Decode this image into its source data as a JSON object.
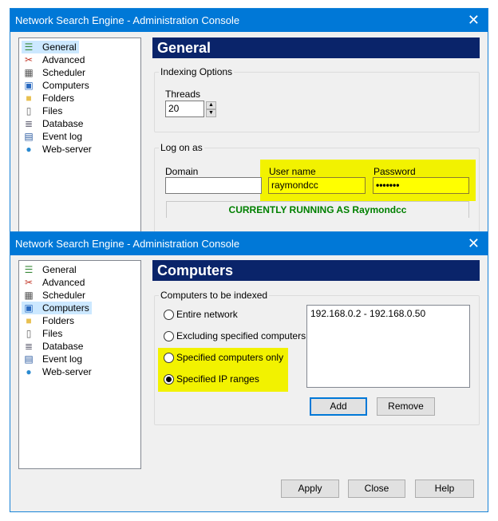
{
  "window_title": "Network Search Engine - Administration Console",
  "tree": [
    {
      "label": "General",
      "icon": "list-icon"
    },
    {
      "label": "Advanced",
      "icon": "tools-icon"
    },
    {
      "label": "Scheduler",
      "icon": "calendar-clock-icon"
    },
    {
      "label": "Computers",
      "icon": "network-icon"
    },
    {
      "label": "Folders",
      "icon": "folder-icon"
    },
    {
      "label": "Files",
      "icon": "file-icon"
    },
    {
      "label": "Database",
      "icon": "database-icon"
    },
    {
      "label": "Event log",
      "icon": "event-log-icon"
    },
    {
      "label": "Web-server",
      "icon": "globe-icon"
    }
  ],
  "general": {
    "header": "General",
    "indexing_group": "Indexing Options",
    "threads_label": "Threads",
    "threads_value": "20",
    "logon_group": "Log on as",
    "domain_label": "Domain",
    "domain_value": "",
    "username_label": "User name",
    "username_value": "raymondcc",
    "password_label": "Password",
    "password_value": "•••••••",
    "status": "CURRENTLY RUNNING AS Raymondcc"
  },
  "computers": {
    "header": "Computers",
    "group": "Computers to be indexed",
    "options": [
      "Entire network",
      "Excluding specified computers",
      "Specified computers only",
      "Specified IP ranges"
    ],
    "selected": "Specified IP ranges",
    "ip_ranges": [
      "192.168.0.2 - 192.168.0.50"
    ],
    "add": "Add",
    "remove": "Remove"
  },
  "buttons": {
    "apply": "Apply",
    "close": "Close",
    "help": "Help"
  },
  "colors": {
    "titlebar": "#0078d7",
    "header": "#0a246a",
    "highlight": "#f2f200",
    "status": "#008000"
  }
}
